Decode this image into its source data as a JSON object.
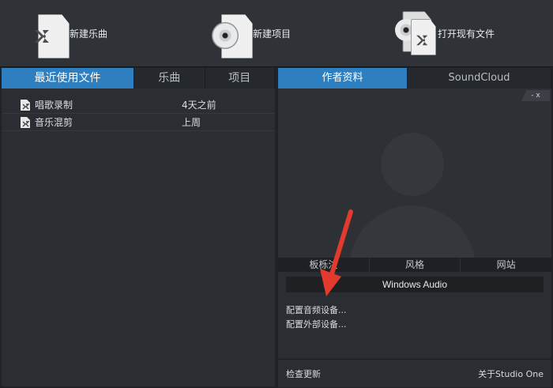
{
  "actions": [
    {
      "label": "新建乐曲",
      "icon": "new-song-icon"
    },
    {
      "label": "新建项目",
      "icon": "new-project-icon"
    },
    {
      "label": "打开现有文件",
      "icon": "open-file-icon"
    }
  ],
  "left": {
    "tabs": [
      "最近使用文件",
      "乐曲",
      "项目"
    ],
    "rows": [
      {
        "name": "唱歌录制",
        "date": "4天之前"
      },
      {
        "name": "音乐混剪",
        "date": "上周"
      }
    ]
  },
  "right": {
    "tabs": [
      "作者资料",
      "SoundCloud"
    ],
    "window_controls": "- x",
    "subtabs": [
      "板栎注",
      "风格",
      "网站"
    ],
    "device_label": "Windows Audio",
    "config_links": [
      "配置音频设备...",
      "配置外部设备..."
    ],
    "footer": {
      "left": "检查更新",
      "right": "关于Studio One"
    }
  },
  "colors": {
    "accent": "#2e7fc0",
    "arrow": "#e23b2e"
  }
}
